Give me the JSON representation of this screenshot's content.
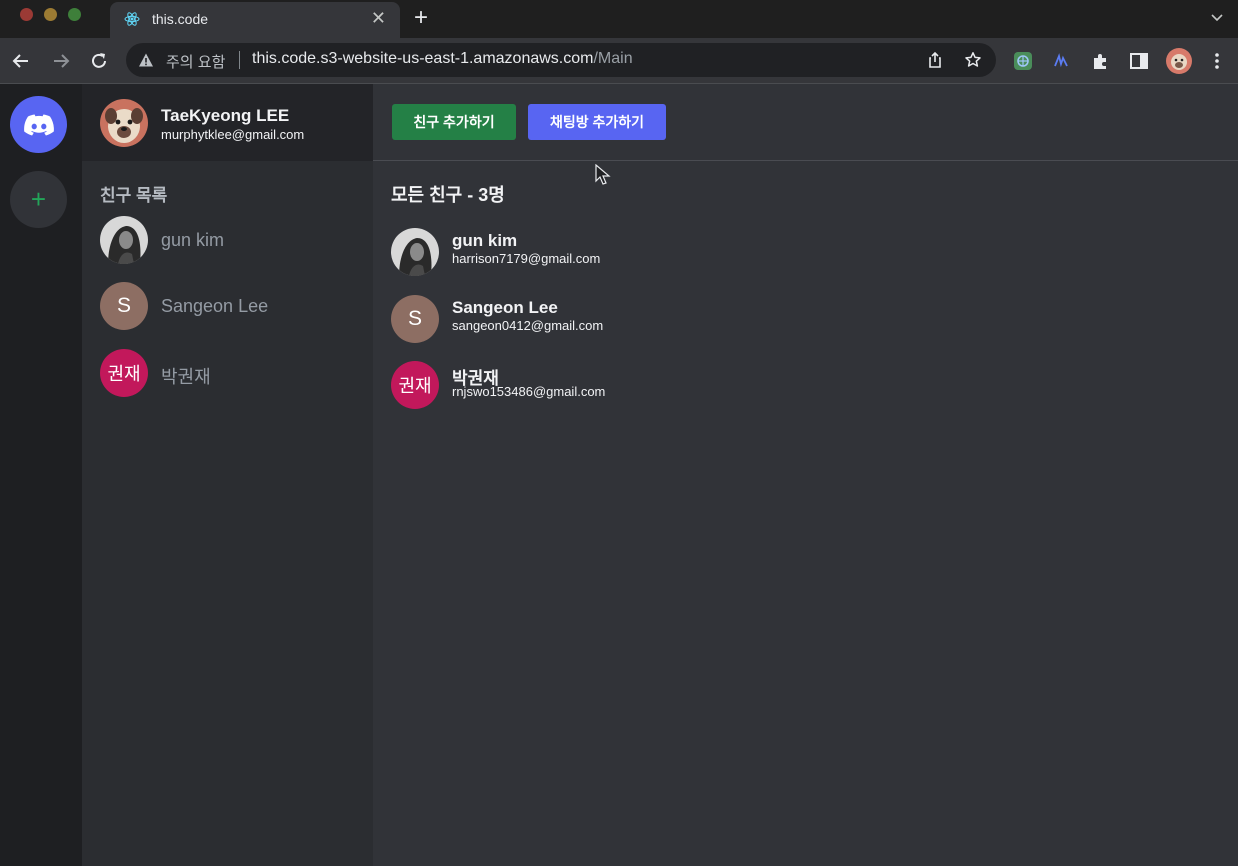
{
  "browser": {
    "tab_title": "this.code",
    "close_glyph": "✕",
    "new_tab_glyph": "+",
    "security_warning": "주의 요함",
    "url_host": "this.code.s3-website-us-east-1.amazonaws.com",
    "url_path": "/Main"
  },
  "user": {
    "name": "TaeKyeong LEE",
    "email": "murphytklee@gmail.com"
  },
  "rail": {
    "add_glyph": "+",
    "accent_color": "#5865f2",
    "add_color": "#23a559"
  },
  "sidebar": {
    "heading": "친구 목록",
    "friends": [
      {
        "name": "gun kim",
        "avatar_type": "photo"
      },
      {
        "name": "Sangeon Lee",
        "avatar_letter": "S",
        "avatar_color": "#8d6e63"
      },
      {
        "name": "박권재",
        "avatar_letter": "권재",
        "avatar_color": "#c2185b"
      }
    ]
  },
  "main": {
    "add_friend_label": "친구 추가하기",
    "add_chat_label": "채팅방 추가하기",
    "list_heading": "모든 친구 - 3명",
    "contacts": [
      {
        "name": "gun kim",
        "email": "harrison7179@gmail.com",
        "avatar_type": "photo"
      },
      {
        "name": "Sangeon Lee",
        "email": "sangeon0412@gmail.com",
        "avatar_letter": "S",
        "avatar_color": "#8d6e63"
      },
      {
        "name": "박권재",
        "email": "rnjswo153486@gmail.com",
        "avatar_letter": "권재",
        "avatar_color": "#c2185b"
      }
    ]
  }
}
